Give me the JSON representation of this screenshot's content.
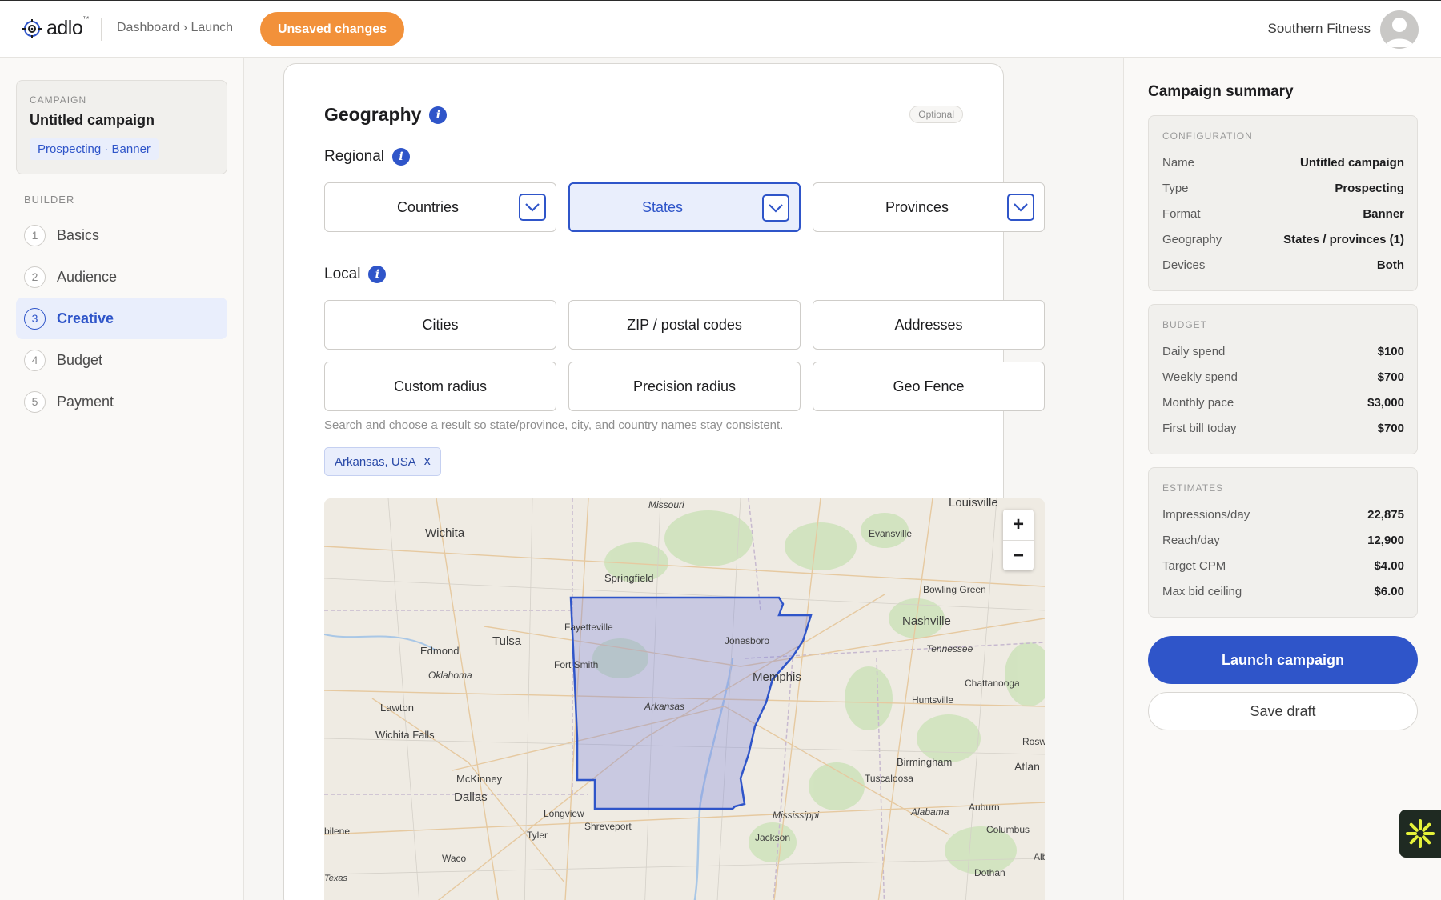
{
  "header": {
    "logo_text": "adlo",
    "logo_tm": "™",
    "breadcrumb": "Dashboard › Launch",
    "unsaved_label": "Unsaved changes",
    "account_name": "Southern Fitness"
  },
  "sidebar": {
    "campaign_kicker": "CAMPAIGN",
    "campaign_name": "Untitled campaign",
    "campaign_tags": "Prospecting · Banner",
    "builder_label": "BUILDER",
    "steps": [
      {
        "num": "1",
        "label": "Basics",
        "active": false
      },
      {
        "num": "2",
        "label": "Audience",
        "active": false
      },
      {
        "num": "3",
        "label": "Creative",
        "active": true
      },
      {
        "num": "4",
        "label": "Budget",
        "active": false
      },
      {
        "num": "5",
        "label": "Payment",
        "active": false
      }
    ]
  },
  "geography": {
    "title": "Geography",
    "optional_badge": "Optional",
    "regional_label": "Regional",
    "regional_options": [
      "Countries",
      "States",
      "Provinces"
    ],
    "selected_regional": "States",
    "local_label": "Local",
    "local_options": [
      "Cities",
      "ZIP / postal codes",
      "Addresses",
      "Custom radius",
      "Precision radius",
      "Geo Fence"
    ],
    "helper_text": "Search and choose a result so state/province, city, and country names stay consistent.",
    "selected_chip": "Arkansas, USA",
    "chip_remove": "x"
  },
  "map": {
    "zoom_in": "+",
    "zoom_out": "−",
    "labels": {
      "louisville": "Louisville",
      "missouri": "Missouri",
      "wichita": "Wichita",
      "evansville": "Evansville",
      "springfield": "Springfield",
      "bowling_green": "Bowling Green",
      "tulsa": "Tulsa",
      "fayetteville": "Fayetteville",
      "jonesboro": "Jonesboro",
      "nashville": "Nashville",
      "edmond": "Edmond",
      "oklahoma": "Oklahoma",
      "tennessee": "Tennessee",
      "fort_smith": "Fort Smith",
      "memphis": "Memphis",
      "chattanooga": "Chattanooga",
      "arkansas": "Arkansas",
      "lawton": "Lawton",
      "huntsville": "Huntsville",
      "wichita_falls": "Wichita Falls",
      "birmingham": "Birmingham",
      "tuscaloosa": "Tuscaloosa",
      "atlanta": "Atlan",
      "mckinney": "McKinney",
      "dallas": "Dallas",
      "longview": "Longview",
      "mississippi": "Mississippi",
      "alabama": "Alabama",
      "auburn": "Auburn",
      "shreveport": "Shreveport",
      "tyler": "Tyler",
      "abilene": "bilene",
      "jackson": "Jackson",
      "columbus": "Columbus",
      "waco": "Waco",
      "texas": "Texas",
      "dothan": "Dothan",
      "rosw": "Rosw",
      "alb": "Alb"
    }
  },
  "summary": {
    "title": "Campaign summary",
    "configuration": {
      "kicker": "CONFIGURATION",
      "rows": [
        {
          "label": "Name",
          "value": "Untitled campaign"
        },
        {
          "label": "Type",
          "value": "Prospecting"
        },
        {
          "label": "Format",
          "value": "Banner"
        },
        {
          "label": "Geography",
          "value": "States / provinces (1)"
        },
        {
          "label": "Devices",
          "value": "Both"
        }
      ]
    },
    "budget": {
      "kicker": "BUDGET",
      "rows": [
        {
          "label": "Daily spend",
          "value": "$100"
        },
        {
          "label": "Weekly spend",
          "value": "$700"
        },
        {
          "label": "Monthly pace",
          "value": "$3,000"
        },
        {
          "label": "First bill today",
          "value": "$700"
        }
      ]
    },
    "estimates": {
      "kicker": "ESTIMATES",
      "rows": [
        {
          "label": "Impressions/day",
          "value": "22,875"
        },
        {
          "label": "Reach/day",
          "value": "12,900"
        },
        {
          "label": "Target CPM",
          "value": "$4.00"
        },
        {
          "label": "Max bid ceiling",
          "value": "$6.00"
        }
      ]
    },
    "launch_label": "Launch campaign",
    "save_label": "Save draft"
  },
  "colors": {
    "brand_blue": "#2f55c9",
    "unsaved_orange": "#f2913a",
    "selection_fill": "#e9eefc"
  }
}
